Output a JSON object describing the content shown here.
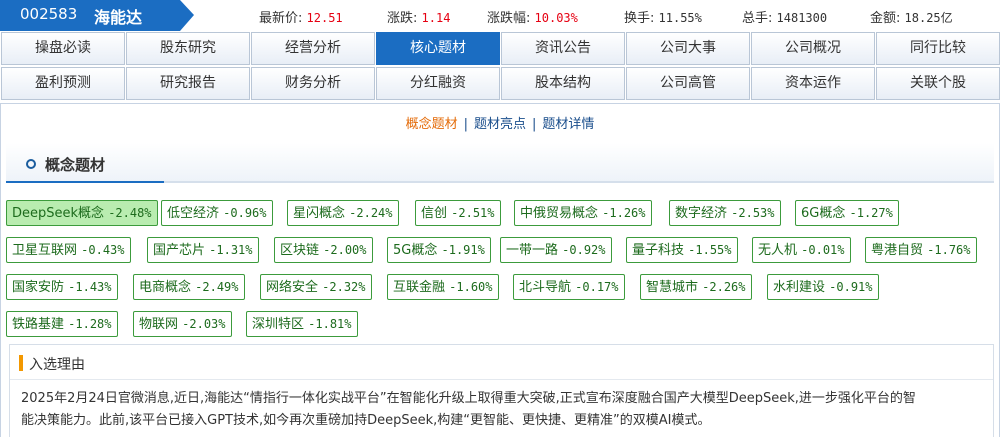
{
  "stock": {
    "code": "002583",
    "name": "海能达"
  },
  "quote": [
    {
      "label": "最新价:",
      "value": "12.51",
      "color": "red"
    },
    {
      "label": "涨跌:",
      "value": "1.14",
      "color": "red"
    },
    {
      "label": "涨跌幅:",
      "value": "10.03%",
      "color": "red"
    },
    {
      "label": "换手:",
      "value": "11.55%",
      "color": "dark"
    },
    {
      "label": "总手:",
      "value": "1481300",
      "color": "dark"
    },
    {
      "label": "金额:",
      "value": "18.25亿",
      "color": "dark"
    }
  ],
  "nav": {
    "row1": [
      "操盘必读",
      "股东研究",
      "经营分析",
      "核心题材",
      "资讯公告",
      "公司大事",
      "公司概况",
      "同行比较"
    ],
    "row2": [
      "盈利预测",
      "研究报告",
      "财务分析",
      "分红融资",
      "股本结构",
      "公司高管",
      "资本运作",
      "关联个股"
    ],
    "active": "核心题材"
  },
  "subtabs": {
    "tab1": "概念题材",
    "tab2": "题材亮点",
    "tab3": "题材详情",
    "sep": "|"
  },
  "section": {
    "title": "概念题材"
  },
  "tags": [
    {
      "name": "DeepSeek概念",
      "pct": "-2.48%",
      "highlight": true
    },
    {
      "name": "低空经济",
      "pct": "-0.96%"
    },
    {
      "name": "星闪概念",
      "pct": "-2.24%"
    },
    {
      "name": "信创",
      "pct": "-2.51%"
    },
    {
      "name": "中俄贸易概念",
      "pct": "-1.26%"
    },
    {
      "name": "数字经济",
      "pct": "-2.53%"
    },
    {
      "name": "6G概念",
      "pct": "-1.27%"
    },
    {
      "name": "卫星互联网",
      "pct": "-0.43%"
    },
    {
      "name": "国产芯片",
      "pct": "-1.31%"
    },
    {
      "name": "区块链",
      "pct": "-2.00%"
    },
    {
      "name": "5G概念",
      "pct": "-1.91%"
    },
    {
      "name": "一带一路",
      "pct": "-0.92%"
    },
    {
      "name": "量子科技",
      "pct": "-1.55%"
    },
    {
      "name": "无人机",
      "pct": "-0.01%"
    },
    {
      "name": "粤港自贸",
      "pct": "-1.76%"
    },
    {
      "name": "国家安防",
      "pct": "-1.43%"
    },
    {
      "name": "电商概念",
      "pct": "-2.49%"
    },
    {
      "name": "网络安全",
      "pct": "-2.32%"
    },
    {
      "name": "互联金融",
      "pct": "-1.60%"
    },
    {
      "name": "北斗导航",
      "pct": "-0.17%"
    },
    {
      "name": "智慧城市",
      "pct": "-2.26%"
    },
    {
      "name": "水利建设",
      "pct": "-0.91%"
    },
    {
      "name": "铁路基建",
      "pct": "-1.28%"
    },
    {
      "name": "物联网",
      "pct": "-2.03%"
    },
    {
      "name": "深圳特区",
      "pct": "-1.81%"
    }
  ],
  "reason": {
    "title": "入选理由",
    "line1": "2025年2月24日官微消息,近日,海能达“情指行一体化实战平台”在智能化升级上取得重大突破,正式宣布深度融合国产大模型DeepSeek,进一步强化平台的智",
    "line2": "能决策能力。此前,该平台已接入GPT技术,如今再次重磅加持DeepSeek,构建“更智能、更快捷、更精准”的双模AI模式。"
  },
  "colors": {
    "accent": "#1b6dc2",
    "up": "#e60012",
    "tag_border": "#3c9b3c",
    "tag_text": "#1d6b1d",
    "tag_highlight": "#b9ecb0",
    "subtab_current": "#e46c0a"
  }
}
